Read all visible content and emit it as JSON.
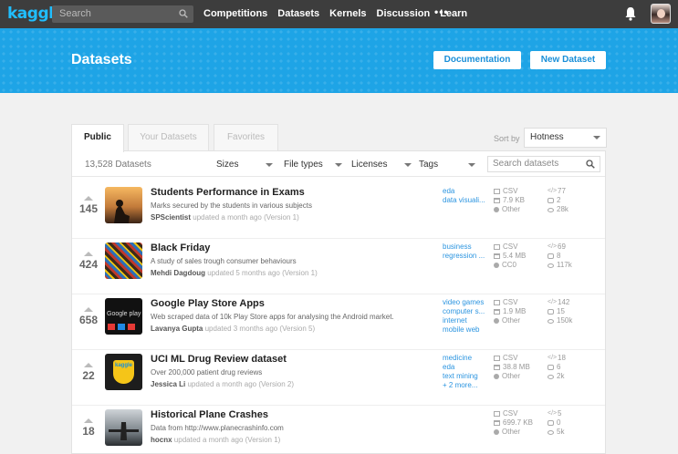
{
  "nav": {
    "logo": "kaggle",
    "search_placeholder": "Search",
    "links": [
      "Competitions",
      "Datasets",
      "Kernels",
      "Discussion",
      "Learn"
    ],
    "more": "•••"
  },
  "banner": {
    "title": "Datasets",
    "documentation_label": "Documentation",
    "new_dataset_label": "New Dataset"
  },
  "tabs": [
    "Public",
    "Your Datasets",
    "Favorites"
  ],
  "sort": {
    "label": "Sort by",
    "value": "Hotness"
  },
  "filters": {
    "count": "13,528 Datasets",
    "sizes": "Sizes",
    "file_types": "File types",
    "licenses": "Licenses",
    "tags": "Tags",
    "search_placeholder": "Search datasets"
  },
  "datasets": [
    {
      "votes": "145",
      "title": "Students Performance in Exams",
      "subtitle": "Marks secured by the students in various subjects",
      "author": "SPScientist",
      "updated": "updated a month ago (Version 1)",
      "tags": [
        "eda",
        "data visuali..."
      ],
      "format": "CSV",
      "size": "7.9 KB",
      "license": "Other",
      "kernels": "77",
      "comments": "2",
      "views": "28k"
    },
    {
      "votes": "424",
      "title": "Black Friday",
      "subtitle": "A study of sales trough consumer behaviours",
      "author": "Mehdi Dagdoug",
      "updated": "updated 5 months ago (Version 1)",
      "tags": [
        "business",
        "regression ..."
      ],
      "format": "CSV",
      "size": "5.4 MB",
      "license": "CC0",
      "kernels": "69",
      "comments": "8",
      "views": "117k"
    },
    {
      "votes": "658",
      "title": "Google Play Store Apps",
      "subtitle": "Web scraped data of 10k Play Store apps for analysing the Android market.",
      "author": "Lavanya Gupta",
      "updated": "updated 3 months ago (Version 5)",
      "tags": [
        "video games",
        "computer s...",
        "internet",
        "mobile web"
      ],
      "format": "CSV",
      "size": "1.9 MB",
      "license": "Other",
      "kernels": "142",
      "comments": "15",
      "views": "150k"
    },
    {
      "votes": "22",
      "title": "UCI ML Drug Review dataset",
      "subtitle": "Over 200,000 patient drug reviews",
      "author": "Jessica Li",
      "updated": "updated a month ago (Version 2)",
      "tags": [
        "medicine",
        "eda",
        "text mining",
        "+ 2 more..."
      ],
      "format": "CSV",
      "size": "38.8 MB",
      "license": "Other",
      "kernels": "18",
      "comments": "6",
      "views": "2k"
    },
    {
      "votes": "18",
      "title": "Historical Plane Crashes",
      "subtitle": "Data from http://www.planecrashinfo.com",
      "author": "hocnx",
      "updated": "updated a month ago (Version 1)",
      "tags": [],
      "format": "CSV",
      "size": "699.7 KB",
      "license": "Other",
      "kernels": "5",
      "comments": "0",
      "views": "5k"
    }
  ],
  "thumb_text": {
    "google_play": "Google play",
    "kaggle_badge": "kaggle"
  },
  "colors": {
    "nav_bg": "#3d3d3d",
    "banner": "#1ea4e6",
    "link": "#2c95e0",
    "logo": "#20beff"
  }
}
